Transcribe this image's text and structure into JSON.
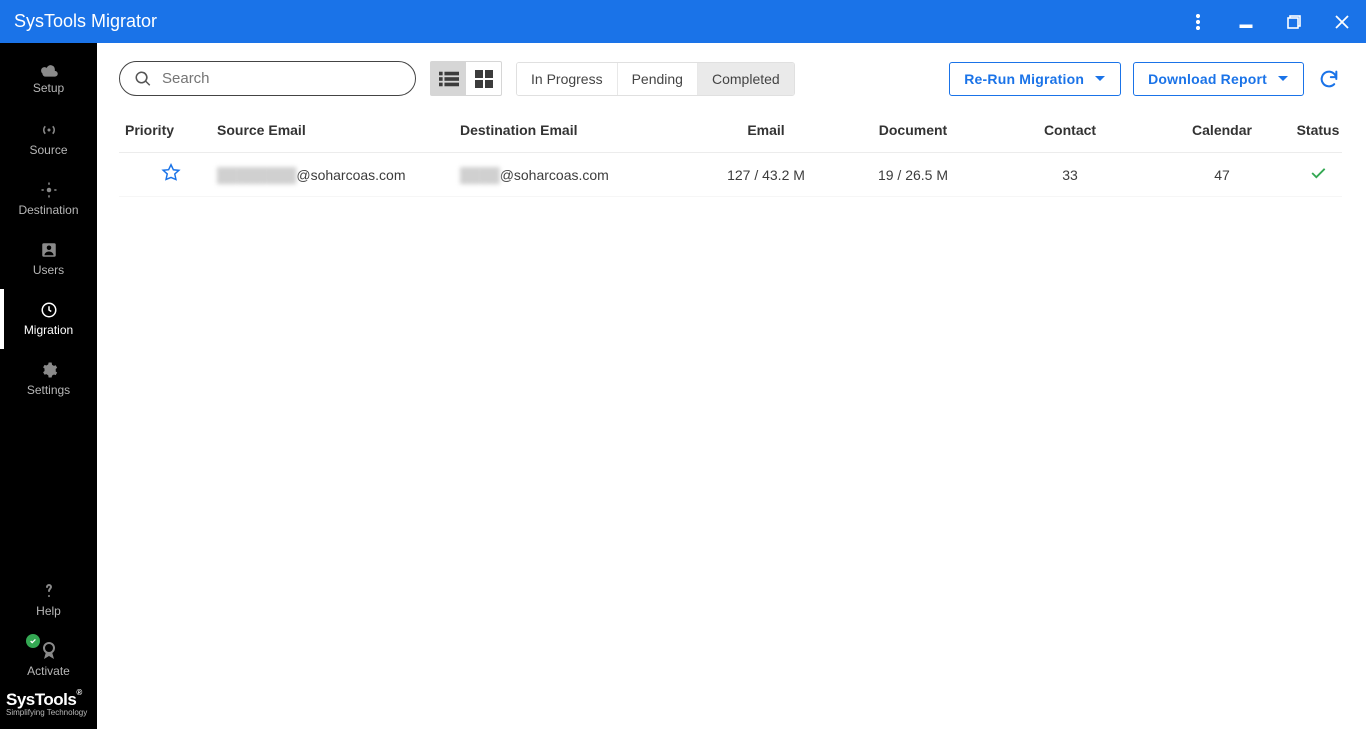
{
  "titlebar": {
    "title": "SysTools Migrator"
  },
  "sidebar": {
    "items": [
      {
        "label": "Setup"
      },
      {
        "label": "Source"
      },
      {
        "label": "Destination"
      },
      {
        "label": "Users"
      },
      {
        "label": "Migration"
      },
      {
        "label": "Settings"
      }
    ],
    "help": {
      "label": "Help"
    },
    "activate": {
      "label": "Activate"
    },
    "brand": {
      "name": "SysTools",
      "tagline": "Simplifying Technology"
    }
  },
  "toolbar": {
    "search_placeholder": "Search",
    "tabs": [
      {
        "label": "In Progress"
      },
      {
        "label": "Pending"
      },
      {
        "label": "Completed"
      }
    ],
    "rerun_label": "Re-Run Migration",
    "download_label": "Download Report"
  },
  "table": {
    "headers": {
      "priority": "Priority",
      "source": "Source Email",
      "dest": "Destination Email",
      "email": "Email",
      "doc": "Document",
      "contact": "Contact",
      "calendar": "Calendar",
      "status": "Status"
    },
    "rows": [
      {
        "source_redacted": "████████",
        "source_domain": "@soharcoas.com",
        "dest_redacted": "████",
        "dest_domain": "@soharcoas.com",
        "email": "127 / 43.2 M",
        "doc": "19 / 26.5 M",
        "contact": "33",
        "calendar": "47"
      }
    ]
  }
}
